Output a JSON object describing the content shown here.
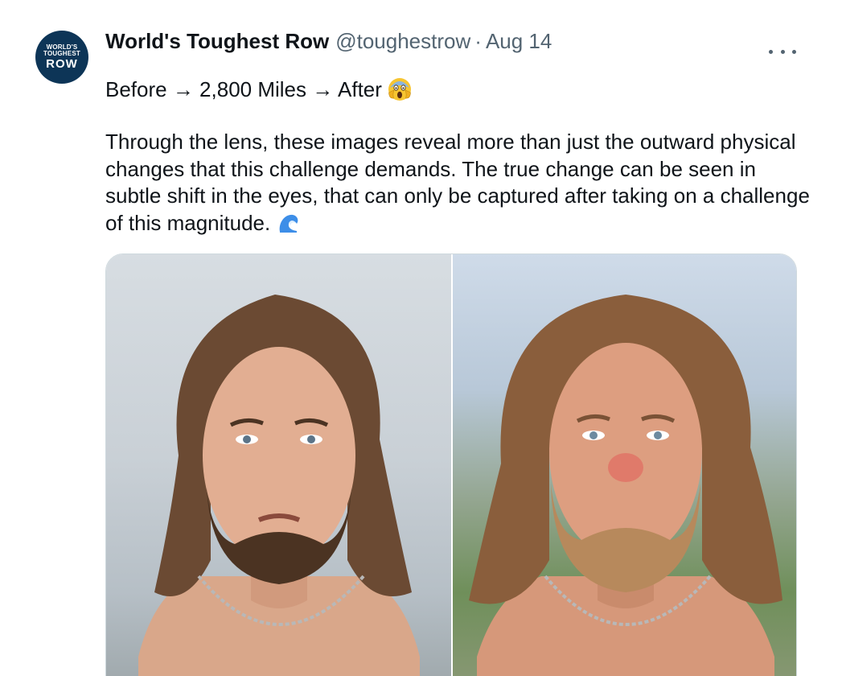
{
  "author": {
    "display_name": "World's Toughest Row",
    "handle": "@toughestrow",
    "separator": "·",
    "date": "Aug 14",
    "avatar": {
      "line1": "WORLD'S",
      "line2": "TOUGHEST",
      "line3": "ROW",
      "bg_color": "#0d3557"
    }
  },
  "tweet": {
    "headline": "Before → 2,800 Miles → After",
    "headline_emoji": "scream-face-emoji",
    "body": "Through the lens, these images reveal more than just the outward physical changes that this challenge demands. The true change can be seen in subtle shift in the eyes, that can only be captured after taking on a challenge of this magnitude.",
    "body_emoji": "water-wave-emoji"
  },
  "media": {
    "photos": [
      {
        "name": "before-photo"
      },
      {
        "name": "after-photo"
      }
    ]
  },
  "colors": {
    "text_primary": "#0f1419",
    "text_secondary": "#536471",
    "border": "#cfd9de"
  }
}
